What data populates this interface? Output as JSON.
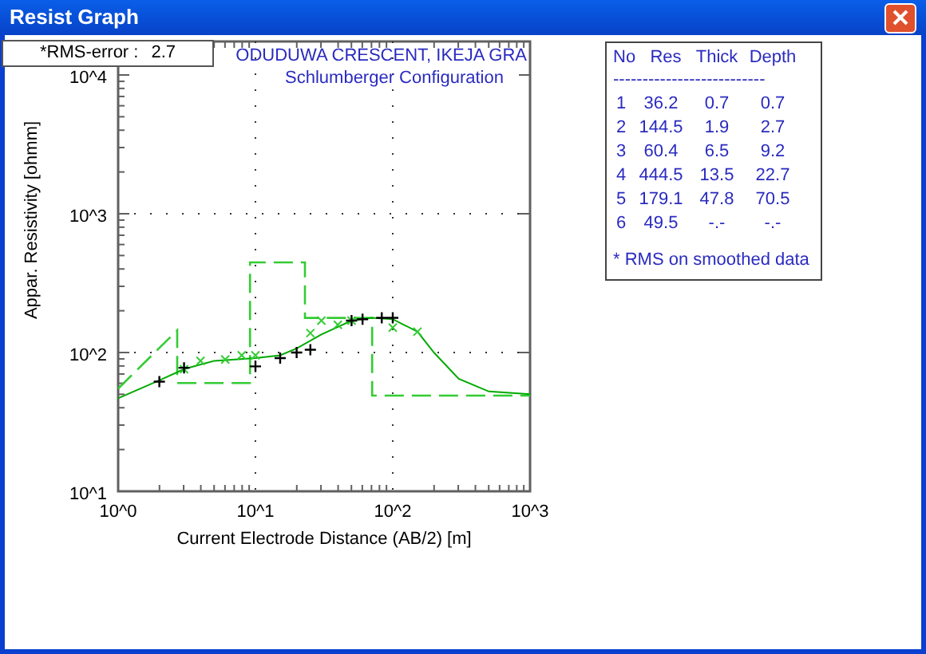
{
  "window": {
    "title": "Resist Graph"
  },
  "rms_box": {
    "label": "*RMS-error :",
    "value": "2.7"
  },
  "chart": {
    "title_lines": [
      "ODUDUWA CRESCENT, IKEJA GRA",
      "Schlumberger Configuration"
    ],
    "x_axis": {
      "title": "Current Electrode Distance (AB/2) [m]",
      "tick_labels": [
        "10^0",
        "10^1",
        "10^2",
        "10^3"
      ]
    },
    "y_axis": {
      "title": "Appar. Resistivity [ohmm]",
      "tick_labels": [
        "10^4",
        "10^3",
        "10^2",
        "10^1"
      ]
    }
  },
  "table": {
    "columns": [
      "No",
      "Res",
      "Thick",
      "Depth"
    ],
    "separator": "--------------------------",
    "rows": [
      [
        "1",
        "36.2",
        "0.7",
        "0.7"
      ],
      [
        "2",
        "144.5",
        "1.9",
        "2.7"
      ],
      [
        "3",
        "60.4",
        "6.5",
        "9.2"
      ],
      [
        "4",
        "444.5",
        "13.5",
        "22.7"
      ],
      [
        "5",
        "179.1",
        "47.8",
        "70.5"
      ],
      [
        "6",
        "49.5",
        "-.-",
        "-.-"
      ]
    ],
    "note": "* RMS on smoothed data"
  }
}
